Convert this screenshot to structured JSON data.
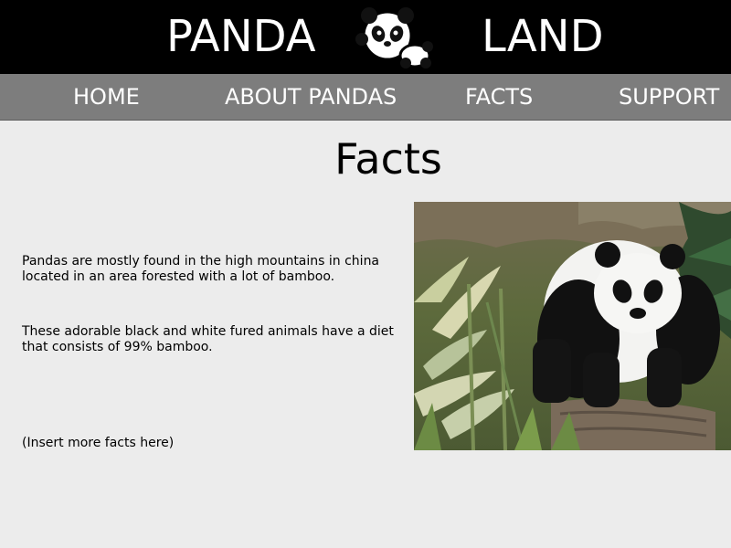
{
  "header": {
    "brand_left": "PANDA",
    "brand_right": "LAND",
    "logo_icon": "panda-logo-icon"
  },
  "nav": {
    "items": [
      {
        "label": "HOME"
      },
      {
        "label": "ABOUT PANDAS"
      },
      {
        "label": "FACTS"
      },
      {
        "label": "SUPPORT"
      }
    ]
  },
  "main": {
    "title": "Facts",
    "facts": [
      "Pandas are mostly found in the high mountains in china located in an area forested with a lot of bamboo.",
      "These adorable black and white fured animals have a diet that consists of 99% bamboo.",
      "(Insert more facts here)"
    ],
    "photo_icon": "panda-photo"
  },
  "colors": {
    "header_bg": "#000000",
    "nav_bg": "#7d7d7d",
    "page_bg": "#ececec",
    "nav_text": "#ffffff"
  }
}
